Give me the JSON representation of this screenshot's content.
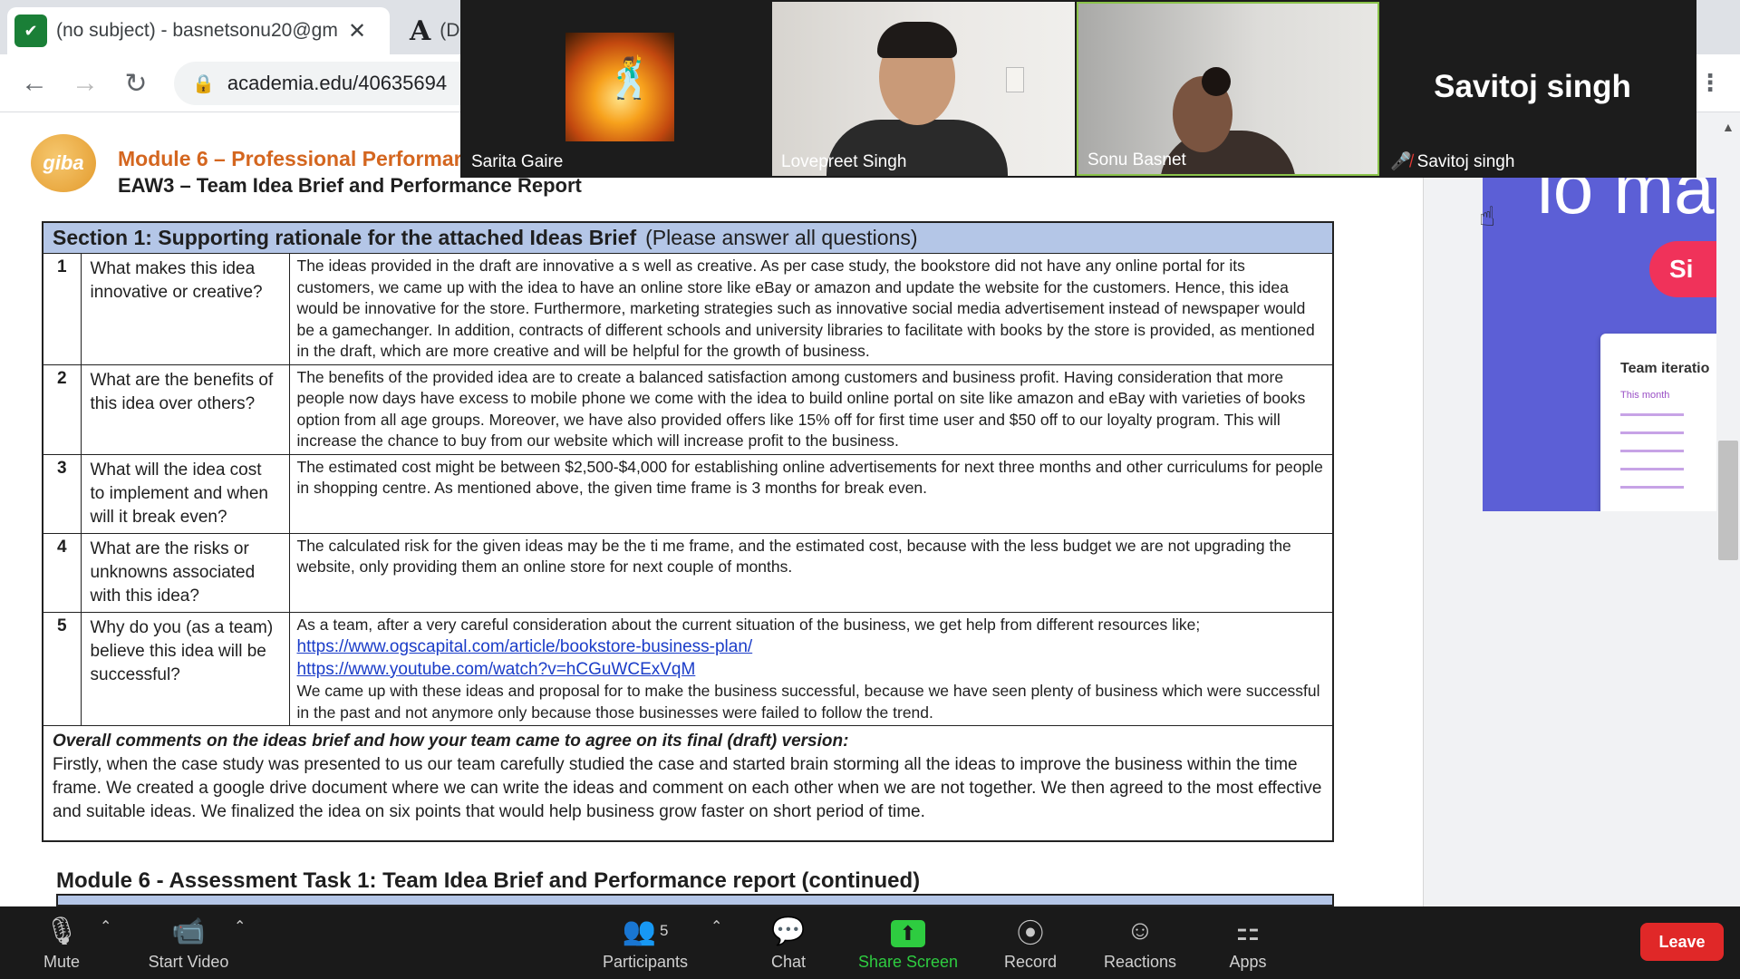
{
  "browser": {
    "active_tab_title": "(no subject) - basnetsonu20@gm",
    "inactive_tab_label": "(D",
    "url": "academia.edu/40635694",
    "tab_close_glyph": "✕"
  },
  "document": {
    "module_title": "Module 6 – Professional Performar",
    "subtitle": "EAW3 – Team Idea Brief and Performance Report",
    "section_title": "Section 1: Supporting rationale for the attached Ideas Brief",
    "section_note": "(Please answer all questions)",
    "questions": [
      {
        "num": "1",
        "question": "What makes this idea innovative or creative?",
        "answer": "The ideas provided in the draft are innovative a s well as creative. As per case study, the bookstore did not have any online portal for its customers, we came up with the idea to have an online store like eBay or amazon and  update the website for the customers. Hence, this idea would be innovative for the store. Furthermore, marketing strategies such as innovative social media advertisement instead of newspaper would be a gamechanger. In addition, contracts of different schools and university libraries to facilitate with books by the store is provided, as mentioned in the draft, which are more creative and will be helpful for the growth of business."
      },
      {
        "num": "2",
        "question": "What are the benefits of this idea over others?",
        "answer": "The benefits of the provided idea are to create a balanced satisfaction among customers and business profit. Having consideration that  more people now days have excess to mobile phone we come with the idea to build  online portal on site like amazon and eBay  with varieties of books option from all age groups.  Moreover, we have also provided offers like 15% off for first time user and $50 off to our loyalty program. This will increase the chance to buy from our website which will increase profit to the business."
      },
      {
        "num": "3",
        "question": "What will the idea cost to implement and when will it break even?",
        "answer": "The estimated cost might be between $2,500-$4,000 for establishing online advertisements for next three months and other curriculums for people in shopping centre. As mentioned above, the given time frame is 3  months for break even."
      },
      {
        "num": "4",
        "question": "What are the risks or unknowns associated with this idea?",
        "answer": "The calculated risk for the given ideas may be the ti me frame, and the estimated cost, because with the less budget we are not upgrading the website, only providing them an online store for next couple of months."
      },
      {
        "num": "5",
        "question": "Why do you (as a team) believe this idea will be successful?",
        "answer_intro": "As a team, after a very careful consideration about the current situation of the business, we get help from different resources like;",
        "link_1": "https://www.ogscapital.com/article/bookstore-business-plan/",
        "link_2": "https://www.youtube.com/watch?v=hCGuWCExVqM",
        "answer_outro": "We came up with these ideas and proposal for to make the business successful, because we have seen plenty of business which  were successful in the past and not anymore only because those businesses were failed to follow the trend."
      }
    ],
    "overall_heading": "Overall comments on the ideas brief and how  your team came to agree on its final (draft) version:",
    "overall_body": "Firstly, when the case study was  presented to us our  team carefully studied the case and started brain storming all the ideas  to improve the business within the time frame. We created a google drive document where we can write the ideas  and comment on each other when we  are not together. We then agreed to  the most effective and suitable ideas. We finalized the idea on  six points that would help business  grow faster on short  period of time.",
    "continued_heading": "Module 6 - Assessment Task 1: Team Idea Brief and Performance report (continued)",
    "logo_text": "giba"
  },
  "preview_panel": {
    "big_text": "lo mano",
    "button_text": "Si",
    "card_title": "Team iteratio",
    "card_subtitle": "This month"
  },
  "video": {
    "participants": [
      {
        "name": "Sarita Gaire"
      },
      {
        "name": "Lovepreet Singh"
      },
      {
        "name": "Sonu Basnet"
      },
      {
        "name": "Savitoj singh",
        "muted": true
      }
    ],
    "big_name": "Savitoj singh"
  },
  "zoom_controls": {
    "mute": "Mute",
    "start_video": "Start Video",
    "participants": "Participants",
    "participants_count": "5",
    "chat": "Chat",
    "share_screen": "Share Screen",
    "record": "Record",
    "reactions": "Reactions",
    "apps": "Apps",
    "leave": "Leave",
    "accent_green": "#2ecc40",
    "leave_red": "#e02828"
  }
}
